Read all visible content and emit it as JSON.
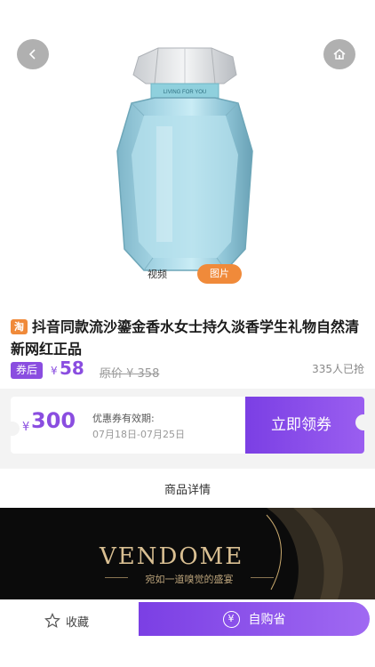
{
  "media": {
    "video_tab": "视频",
    "image_tab": "图片"
  },
  "product": {
    "platform_badge": "淘",
    "title": "抖音同款流沙鎏金香水女士持久淡香学生礼物自然清新网红正品",
    "after_coupon_label": "券后",
    "currency": "¥",
    "price": "58",
    "original_price": "原价 ¥ 358",
    "sold_count": "335人已抢"
  },
  "coupon": {
    "currency": "¥",
    "amount": "300",
    "validity_label": "优惠券有效期:",
    "date_range": "07月18日-07月25日",
    "claim_button": "立即领券"
  },
  "details": {
    "heading": "商品详情"
  },
  "banner": {
    "brand": "VENDOME",
    "slogan": "宛如一道嗅觉的盛宴"
  },
  "bottom_bar": {
    "favorite_label": "收藏",
    "buy_icon": "¥",
    "buy_label": "自购省"
  },
  "colors": {
    "accent": "#8a4de0",
    "orange": "#f08a3a",
    "banner_bg": "#0b0b0b",
    "gold": "#d9bf92"
  }
}
